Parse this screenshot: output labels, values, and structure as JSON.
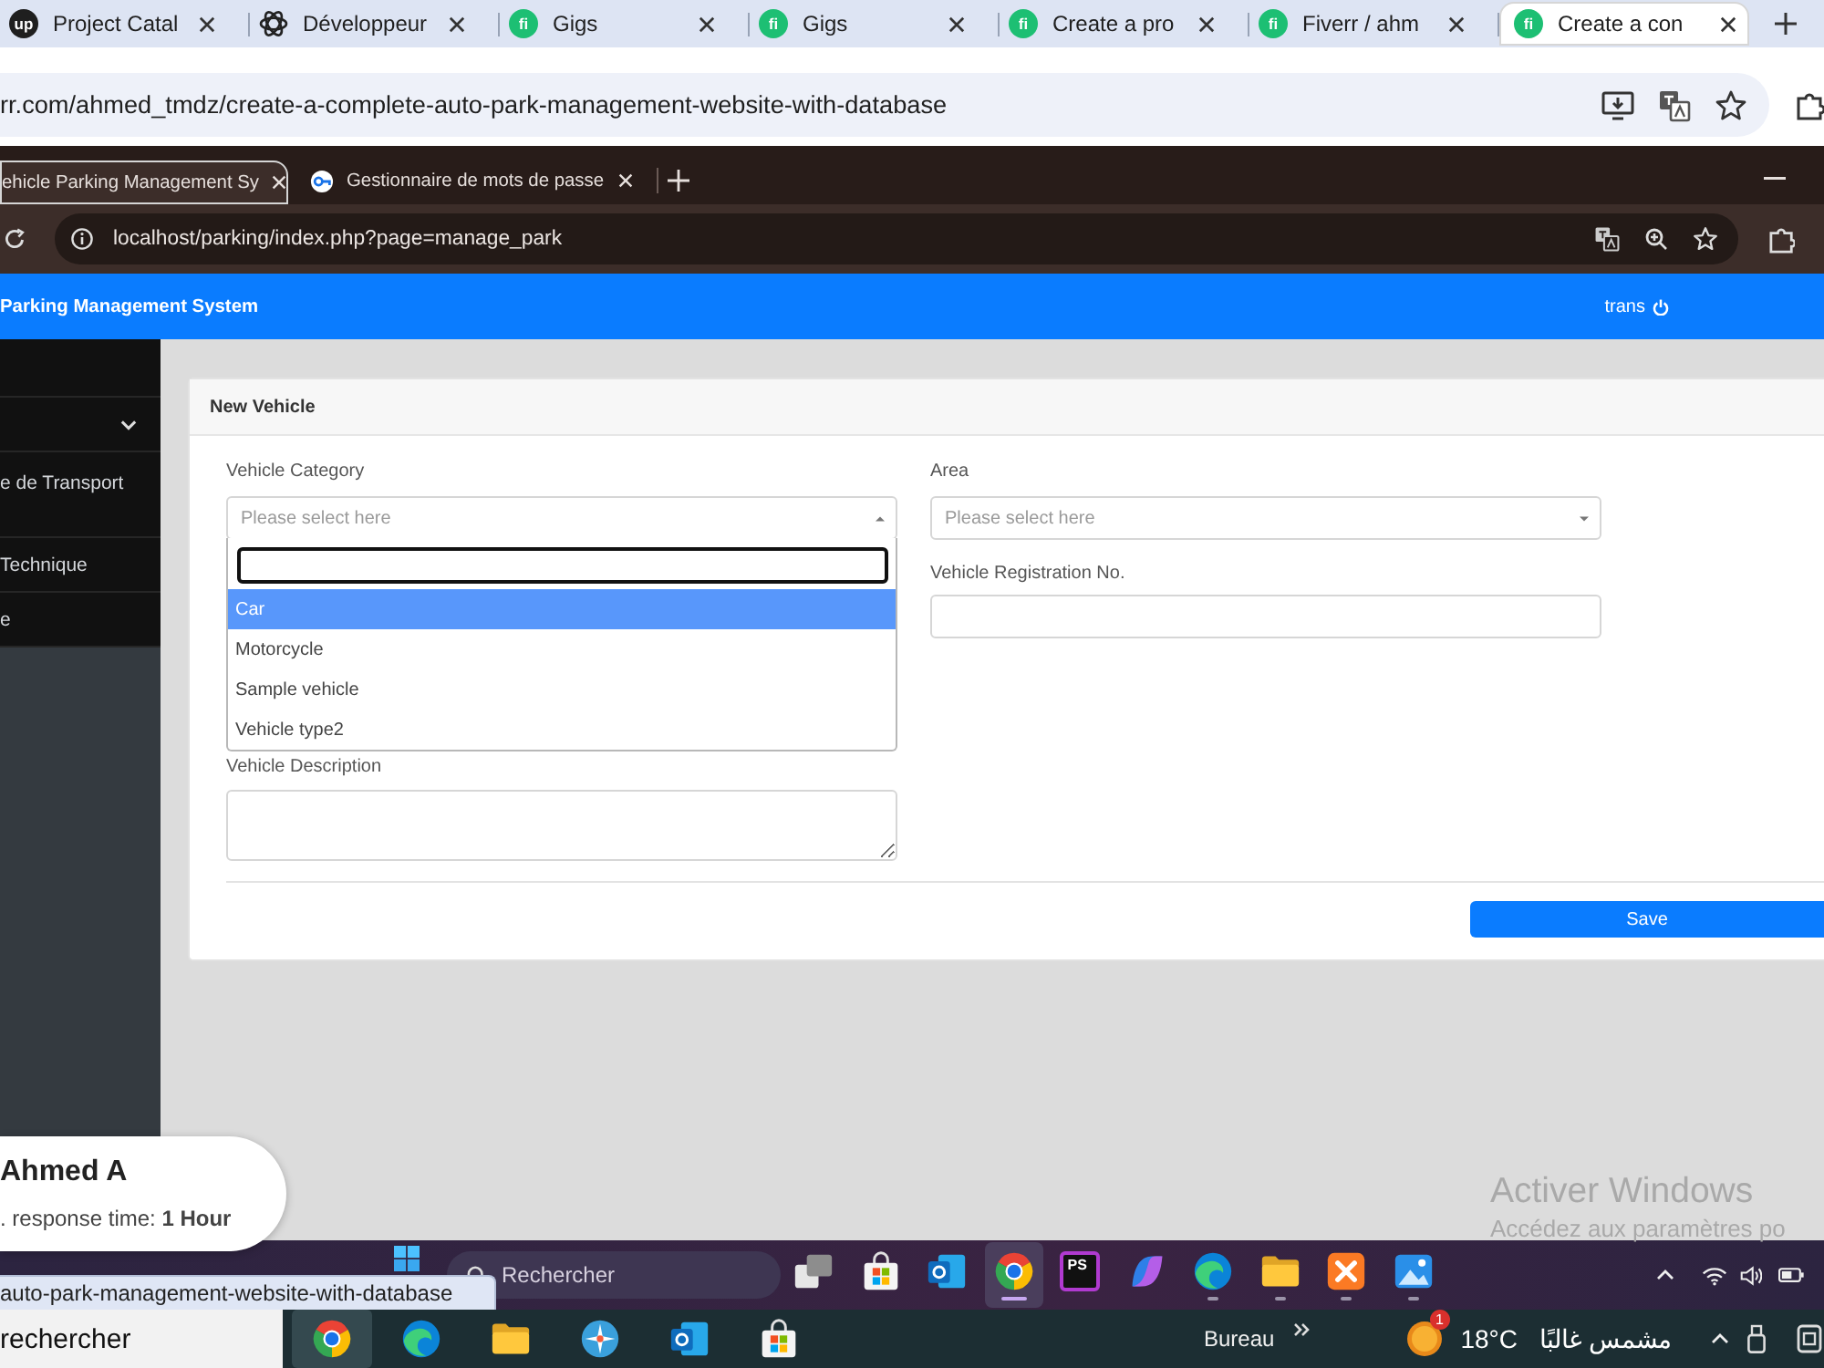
{
  "browser": {
    "tabs": [
      {
        "title": "Project Catal",
        "kind": "letters",
        "logo": "up",
        "color": "#1f1f1f",
        "selected": false
      },
      {
        "title": "Développeur",
        "kind": "knot",
        "selected": false
      },
      {
        "title": "Gigs",
        "kind": "letters",
        "logo": "fi",
        "color": "#1dbf73",
        "selected": false
      },
      {
        "title": "Gigs",
        "kind": "letters",
        "logo": "fi",
        "color": "#1dbf73",
        "selected": false
      },
      {
        "title": "Create a pro",
        "kind": "letters",
        "logo": "fi",
        "color": "#1dbf73",
        "selected": false
      },
      {
        "title": "Fiverr / ahm",
        "kind": "letters",
        "logo": "fi",
        "color": "#1dbf73",
        "selected": false
      },
      {
        "title": "Create a con",
        "kind": "letters",
        "logo": "fi",
        "color": "#1dbf73",
        "selected": true
      }
    ],
    "url": "rr.com/ahmed_tmdz/create-a-complete-auto-park-management-website-with-database"
  },
  "embedded_screenshot": {
    "tabs": [
      {
        "title": "ehicle Parking Management Sy",
        "kind": "plain",
        "selected": true
      },
      {
        "title": "Gestionnaire de mots de passe",
        "kind": "key",
        "selected": false
      }
    ],
    "url": "localhost/parking/index.php?page=manage_park",
    "app_title": "Parking Management System",
    "user": "trans",
    "sidebar": [
      {
        "kind": "group"
      },
      {
        "kind": "link",
        "label": "e de Transport"
      },
      {
        "kind": "link",
        "label": "Technique"
      },
      {
        "kind": "link",
        "label": "e"
      }
    ],
    "form": {
      "title": "New Vehicle",
      "vehicle_category": {
        "label": "Vehicle Category",
        "placeholder": "Please select here",
        "expanded": true,
        "options": [
          {
            "label": "Car",
            "selected": true
          },
          {
            "label": "Motorcycle",
            "selected": false
          },
          {
            "label": "Sample vehicle",
            "selected": false
          },
          {
            "label": "Vehicle type2",
            "selected": false
          }
        ]
      },
      "vehicle_description": {
        "label": "Vehicle Description"
      },
      "area": {
        "label": "Area",
        "placeholder": "Please select here"
      },
      "vehicle_registration": {
        "label": "Vehicle Registration No."
      },
      "save_button": "Save"
    },
    "taskbar": {
      "search_placeholder": "Rechercher",
      "apps": [
        {
          "kind": "task-view",
          "running": false,
          "active": false
        },
        {
          "kind": "store",
          "running": false,
          "active": false
        },
        {
          "kind": "mail",
          "running": false,
          "active": false
        },
        {
          "kind": "wheel",
          "running": true,
          "active": true
        },
        {
          "kind": "letters",
          "label": "PS",
          "running": false,
          "active": false
        },
        {
          "kind": "swirl",
          "running": false,
          "active": false
        },
        {
          "kind": "wave",
          "running": true,
          "active": false
        },
        {
          "kind": "folder",
          "running": true,
          "active": false
        },
        {
          "kind": "knot",
          "running": true,
          "active": false
        },
        {
          "kind": "picture",
          "running": true,
          "active": false
        }
      ]
    }
  },
  "seller_card": {
    "name": "Ahmed A",
    "response_time": ". response time: **1 Hour**"
  },
  "link_preview": "auto-park-management-website-with-database",
  "activation_notice": {
    "title": "Activer Windows",
    "text": "Accédez aux paramètres po"
  },
  "taskbar": {
    "search_placeholder": "rechercher",
    "apps": [
      {
        "kind": "wheel",
        "active": true
      },
      {
        "kind": "wave",
        "active": false
      },
      {
        "kind": "folder",
        "active": false
      },
      {
        "kind": "compass",
        "active": false
      },
      {
        "kind": "mail",
        "active": false
      },
      {
        "kind": "store",
        "active": false
      }
    ],
    "desktop_label": "Bureau",
    "weather": {
      "badge": "1",
      "temperature": "18°C",
      "condition": "مشمس غالبًا"
    }
  }
}
